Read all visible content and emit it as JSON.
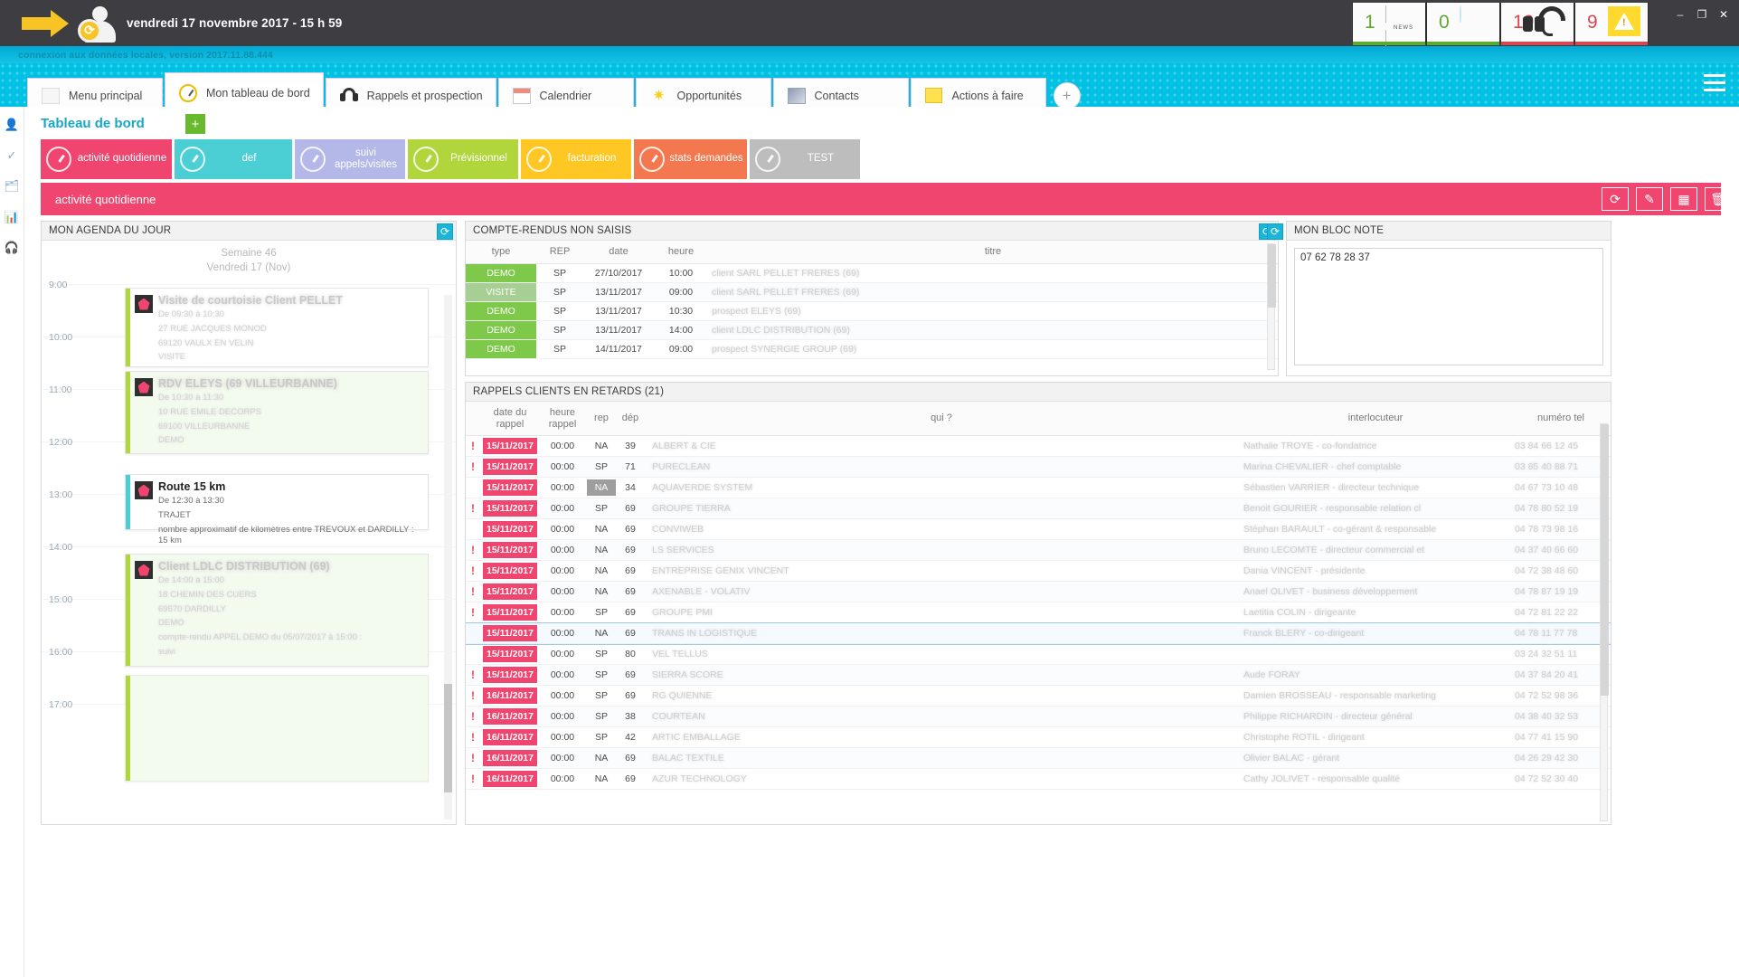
{
  "titlebar": {
    "datetime": "vendredi 17 novembre 2017 - 15 h 59",
    "arrow_icon": "arrow-right-icon",
    "user_icon": "user-avatar-icon",
    "sync_icon": "sync-icon",
    "notifications": [
      {
        "count": "1",
        "icon": "news-icon",
        "accent": "#5fa832"
      },
      {
        "count": "0",
        "icon": "chat-icon",
        "accent": "#5fa832"
      },
      {
        "count": "19",
        "icon": "headset-icon",
        "accent": "#d8474f"
      },
      {
        "count": "9",
        "icon": "warning-icon",
        "accent": "#d8474f"
      }
    ],
    "window_controls": [
      "–",
      "❐",
      "✕"
    ]
  },
  "statusbar": {
    "text": "connexion aux données locales, version 2017.11.88.444"
  },
  "apptabs": [
    {
      "label": "Menu principal",
      "icon": "blank-page-icon",
      "selected": false
    },
    {
      "label": "Mon tableau de bord",
      "icon": "gauge-icon",
      "selected": true
    },
    {
      "label": "Rappels et prospection",
      "icon": "headset-icon",
      "selected": false
    },
    {
      "label": "Calendrier",
      "icon": "calendar-icon",
      "selected": false
    },
    {
      "label": "Opportunités",
      "icon": "star-icon",
      "selected": false
    },
    {
      "label": "Contacts",
      "icon": "contacts-icon",
      "selected": false
    },
    {
      "label": "Actions à faire",
      "icon": "sticky-note-icon",
      "selected": false
    }
  ],
  "apptab_add": "+",
  "dashboard": {
    "title": "Tableau de bord",
    "add_label": "+",
    "tabs": [
      {
        "label": "activité quotidienne",
        "color": "#f0456f",
        "selected": true
      },
      {
        "label": "def",
        "color": "#4ccfd4",
        "selected": false
      },
      {
        "label": "suivi appels/visites",
        "color": "#b3b8e8",
        "selected": false
      },
      {
        "label": "Prévisionnel",
        "color": "#b0d63c",
        "selected": false
      },
      {
        "label": "facturation",
        "color": "#ffc724",
        "selected": false
      },
      {
        "label": "stats demandes",
        "color": "#f4784f",
        "selected": false
      },
      {
        "label": "TEST",
        "color": "#bdbdbd",
        "selected": false
      }
    ],
    "section_title": "activité quotidienne",
    "section_buttons": [
      {
        "name": "refresh-button",
        "glyph": "⟳"
      },
      {
        "name": "edit-button",
        "glyph": "✎"
      },
      {
        "name": "layout-button",
        "glyph": "▦"
      },
      {
        "name": "delete-button",
        "glyph": "🗑"
      }
    ]
  },
  "agenda": {
    "title": "MON AGENDA DU JOUR",
    "week": "Semaine 46",
    "day": "Vendredi 17 (Nov)",
    "hours": [
      "9:00",
      "10:00",
      "11:00",
      "12:00",
      "13:00",
      "14:00",
      "15:00",
      "16:00",
      "17:00"
    ],
    "events": [
      {
        "title": "Visite de courtoisie Client PELLET",
        "time": "De 09:30 à 10:30",
        "lines": [
          "27 RUE JACQUES MONOD",
          "69120 VAULX EN VELIN",
          "VISITE"
        ],
        "color": "#b0d63c",
        "sharp": false
      },
      {
        "title": "RDV ELEYS (69 VILLEURBANNE)",
        "time": "De 10:30 à 11:30",
        "lines": [
          "10 RUE EMILE DECORPS",
          "69100 VILLEURBANNE",
          "DEMO"
        ],
        "color": "#b0d63c",
        "sharp": false
      },
      {
        "title": "Route 15 km",
        "time": "De 12:30 à 13:30",
        "lines": [
          "TRAJET",
          "nombre approximatif de kilomètres entre TREVOUX et DARDILLY : 15 km"
        ],
        "color": "#4ccfd4",
        "sharp": true
      },
      {
        "title": "Client LDLC DISTRIBUTION (69)",
        "time": "De 14:00 à 15:00",
        "lines": [
          "18 CHEMIN DES CUERS",
          "69570 DARDILLY",
          "DEMO",
          "compte-rendu APPEL DEMO du 05/07/2017 à 15:00 :",
          "suivi"
        ],
        "color": "#b0d63c",
        "sharp": false
      }
    ]
  },
  "compte_rendus": {
    "title": "COMPTE-RENDUS NON SAISIS",
    "columns": [
      "type",
      "REP",
      "date",
      "heure",
      "titre"
    ],
    "rows": [
      {
        "type": "DEMO",
        "rep": "SP",
        "date": "27/10/2017",
        "heure": "10:00",
        "titre": "client SARL PELLET FRERES (69)"
      },
      {
        "type": "VISITE",
        "rep": "SP",
        "date": "13/11/2017",
        "heure": "09:00",
        "titre": "client SARL PELLET FRERES (69)"
      },
      {
        "type": "DEMO",
        "rep": "SP",
        "date": "13/11/2017",
        "heure": "10:30",
        "titre": "prospect ELEYS (69)"
      },
      {
        "type": "DEMO",
        "rep": "SP",
        "date": "13/11/2017",
        "heure": "14:00",
        "titre": "client LDLC DISTRIBUTION (69)"
      },
      {
        "type": "DEMO",
        "rep": "SP",
        "date": "14/11/2017",
        "heure": "09:00",
        "titre": "prospect SYNERGIE GROUP (69)"
      }
    ]
  },
  "bloc_note": {
    "title": "MON BLOC NOTE",
    "content": "07 62 78 28 37"
  },
  "rappels": {
    "title": "RAPPELS CLIENTS EN RETARDS (21)",
    "count": 21,
    "columns": [
      "date du rappel",
      "heure rappel",
      "rep",
      "dép",
      "qui ?",
      "interlocuteur",
      "numéro tel"
    ],
    "rows": [
      {
        "date": "15/11/2017",
        "heure": "00:00",
        "rep": "NA",
        "dep": "39",
        "qui": "ALBERT & CIE",
        "interlocuteur": "Nathalie TROYE - co-fondatrice",
        "tel": "03 84 66 12 45",
        "bang": true,
        "selected": false,
        "repgrey": false
      },
      {
        "date": "15/11/2017",
        "heure": "00:00",
        "rep": "SP",
        "dep": "71",
        "qui": "PURECLEAN",
        "interlocuteur": "Marina CHEVALIER - chef comptable",
        "tel": "03 85 40 88 71",
        "bang": true,
        "selected": false,
        "repgrey": false
      },
      {
        "date": "15/11/2017",
        "heure": "00:00",
        "rep": "NA",
        "dep": "34",
        "qui": "AQUAVERDE SYSTEM",
        "interlocuteur": "Sébastien VARRIER - directeur technique",
        "tel": "04 67 73 10 48",
        "bang": false,
        "selected": false,
        "repgrey": true
      },
      {
        "date": "15/11/2017",
        "heure": "00:00",
        "rep": "SP",
        "dep": "69",
        "qui": "GROUPE TIERRA",
        "interlocuteur": "Benoit GOURIER - responsable relation cl",
        "tel": "04 78 80 52 19",
        "bang": true,
        "selected": false,
        "repgrey": false
      },
      {
        "date": "15/11/2017",
        "heure": "00:00",
        "rep": "NA",
        "dep": "69",
        "qui": "CONVIWEB",
        "interlocuteur": "Stéphan BARAULT - co-gérant & responsable",
        "tel": "04 78 73 98 16",
        "bang": false,
        "selected": false,
        "repgrey": false
      },
      {
        "date": "15/11/2017",
        "heure": "00:00",
        "rep": "NA",
        "dep": "69",
        "qui": "LS SERVICES",
        "interlocuteur": "Bruno LECOMTE - directeur commercial et",
        "tel": "04 37 40 66 60",
        "bang": true,
        "selected": false,
        "repgrey": false
      },
      {
        "date": "15/11/2017",
        "heure": "00:00",
        "rep": "NA",
        "dep": "69",
        "qui": "ENTREPRISE GENIX VINCENT",
        "interlocuteur": "Dania VINCENT - présidente",
        "tel": "04 72 38 48 60",
        "bang": true,
        "selected": false,
        "repgrey": false
      },
      {
        "date": "15/11/2017",
        "heure": "00:00",
        "rep": "NA",
        "dep": "69",
        "qui": "AXENABLE - VOLATIV",
        "interlocuteur": "Anael OLIVET - business développement",
        "tel": "04 78 87 19 19",
        "bang": true,
        "selected": false,
        "repgrey": false
      },
      {
        "date": "15/11/2017",
        "heure": "00:00",
        "rep": "SP",
        "dep": "69",
        "qui": "GROUPE PMI",
        "interlocuteur": "Laetitia COLIN - dirigeante",
        "tel": "04 72 81 22 22",
        "bang": true,
        "selected": false,
        "repgrey": false
      },
      {
        "date": "15/11/2017",
        "heure": "00:00",
        "rep": "NA",
        "dep": "69",
        "qui": "TRANS IN LOGISTIQUE",
        "interlocuteur": "Franck BLERY - co-dirigeant",
        "tel": "04 78 11 77 78",
        "bang": false,
        "selected": true,
        "repgrey": false
      },
      {
        "date": "15/11/2017",
        "heure": "00:00",
        "rep": "SP",
        "dep": "80",
        "qui": "VEL TELLUS",
        "interlocuteur": "",
        "tel": "03 24 32 51 11",
        "bang": false,
        "selected": false,
        "repgrey": false
      },
      {
        "date": "15/11/2017",
        "heure": "00:00",
        "rep": "SP",
        "dep": "69",
        "qui": "SIERRA SCORE",
        "interlocuteur": "Aude FORAY",
        "tel": "04 37 84 20 41",
        "bang": true,
        "selected": false,
        "repgrey": false
      },
      {
        "date": "16/11/2017",
        "heure": "00:00",
        "rep": "SP",
        "dep": "69",
        "qui": "RG QUIENNE",
        "interlocuteur": "Damien BROSSEAU - responsable marketing",
        "tel": "04 72 52 98 36",
        "bang": true,
        "selected": false,
        "repgrey": false
      },
      {
        "date": "16/11/2017",
        "heure": "00:00",
        "rep": "SP",
        "dep": "38",
        "qui": "COURTEAN",
        "interlocuteur": "Philippe RICHARDIN - directeur général",
        "tel": "04 38 40 32 53",
        "bang": true,
        "selected": false,
        "repgrey": false
      },
      {
        "date": "16/11/2017",
        "heure": "00:00",
        "rep": "SP",
        "dep": "42",
        "qui": "ARTIC EMBALLAGE",
        "interlocuteur": "Christophe ROTIL - dirigeant",
        "tel": "04 77 41 15 90",
        "bang": true,
        "selected": false,
        "repgrey": false
      },
      {
        "date": "16/11/2017",
        "heure": "00:00",
        "rep": "NA",
        "dep": "69",
        "qui": "BALAC TEXTILE",
        "interlocuteur": "Olivier BALAC - gérant",
        "tel": "04 26 29 42 30",
        "bang": true,
        "selected": false,
        "repgrey": false
      },
      {
        "date": "16/11/2017",
        "heure": "00:00",
        "rep": "NA",
        "dep": "69",
        "qui": "AZUR TECHNOLOGY",
        "interlocuteur": "Cathy JOLIVET - responsable qualité",
        "tel": "04 72 52 30 40",
        "bang": true,
        "selected": false,
        "repgrey": false
      }
    ]
  }
}
